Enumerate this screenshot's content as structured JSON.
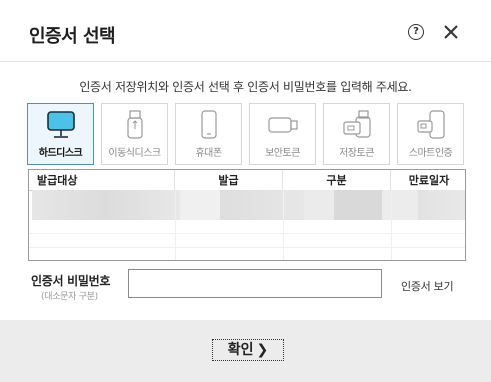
{
  "dialog": {
    "title": "인증서 선택",
    "help_glyph": "?",
    "instruction": "인증서 저장위치와 인증서 선택 후 인증서 비밀번호를 입력해 주세요."
  },
  "devices": [
    {
      "label": "하드디스크",
      "icon": "monitor-icon",
      "selected": true
    },
    {
      "label": "이동식디스크",
      "icon": "usb-drive-icon",
      "selected": false
    },
    {
      "label": "휴대폰",
      "icon": "mobile-phone-icon",
      "selected": false
    },
    {
      "label": "보안토큰",
      "icon": "security-token-icon",
      "selected": false
    },
    {
      "label": "저장토큰",
      "icon": "storage-token-icon",
      "selected": false
    },
    {
      "label": "스마트인증",
      "icon": "smart-auth-icon",
      "selected": false
    }
  ],
  "table": {
    "headers": [
      "발급대상",
      "발급",
      "구분",
      "만료일자"
    ]
  },
  "password": {
    "label": "인증서 비밀번호",
    "hint": "(대소문자 구분)",
    "value": ""
  },
  "view_cert_label": "인증서 보기",
  "ok_button": {
    "label": "확인",
    "chevron": "❯"
  },
  "colors": {
    "selected_border": "#4d8cd0",
    "selected_bg": "#eef6fd",
    "footer_bg": "#ececec"
  }
}
